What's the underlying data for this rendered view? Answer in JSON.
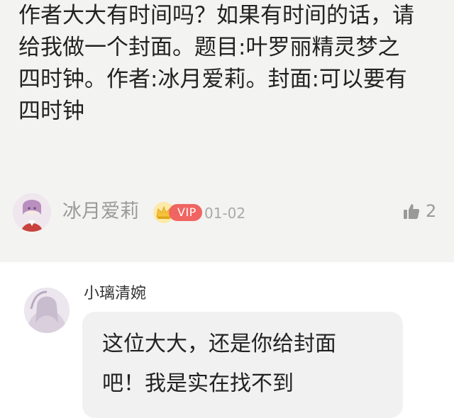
{
  "post": {
    "body": "作者大大有时间吗？如果有时间的话，请\n给我做一个封面。题目:叶罗丽精灵梦之\n四时钟。作者:冰月爱莉。封面:可以要有\n四时钟",
    "author": "冰月爱莉",
    "vip_label": "VIP",
    "date": "01-02",
    "like_count": "2"
  },
  "reply": {
    "author": "小璃清婉",
    "body": "这位大大，还是你给封面\n吧！我是实在找不到"
  },
  "icons": {
    "crown": "crown-icon",
    "like": "thumbs-up-icon"
  },
  "colors": {
    "vip_badge": "#f06461",
    "crown": "#f4c23c",
    "meta_text": "#9a9a9a",
    "card_bg": "#f3f3f1",
    "bubble_bg": "#f1f1f1"
  }
}
